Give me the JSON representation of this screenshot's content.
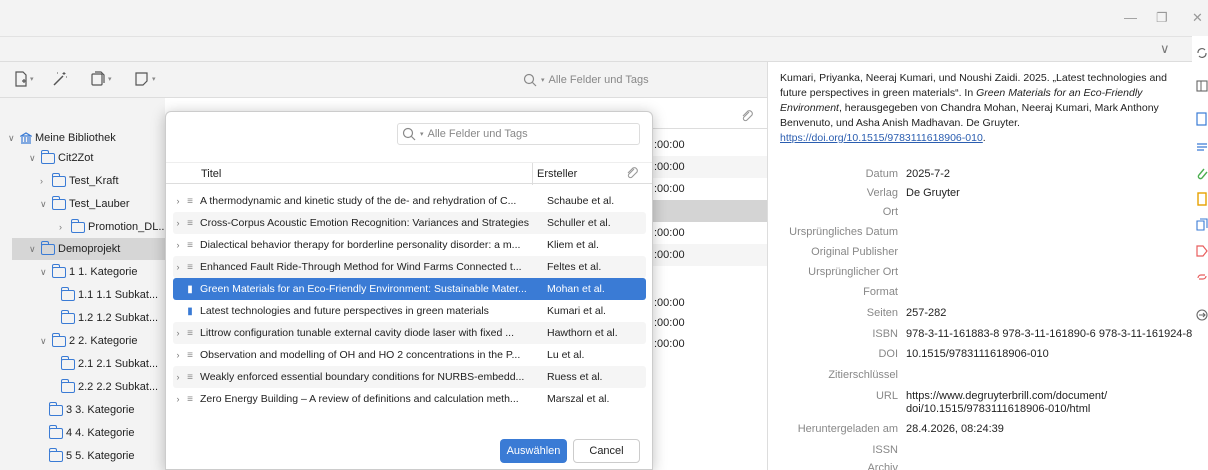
{
  "window": {
    "minimize_glyph": "—",
    "restore_glyph": "❐",
    "close_glyph": "✕",
    "chevron": "∨"
  },
  "toolbar": {
    "search_placeholder": "Alle Felder und Tags"
  },
  "tree": {
    "items": [
      {
        "label": "Meine Bibliothek"
      },
      {
        "label": "Cit2Zot"
      },
      {
        "label": "Test_Kraft"
      },
      {
        "label": "Test_Lauber"
      },
      {
        "label": "Promotion_DL..."
      },
      {
        "label": "Demoprojekt"
      },
      {
        "label": "1 1. Kategorie"
      },
      {
        "label": "1.1 1.1 Subkat..."
      },
      {
        "label": "1.2 1.2 Subkat..."
      },
      {
        "label": "2 2. Kategorie"
      },
      {
        "label": "2.1 2.1 Subkat..."
      },
      {
        "label": "2.2 2.2 Subkat..."
      },
      {
        "label": "3 3. Kategorie"
      },
      {
        "label": "4 4. Kategorie"
      },
      {
        "label": "5 5. Kategorie"
      }
    ]
  },
  "middle": {
    "times": [
      ":00:00",
      ":00:00",
      ":00:00",
      "",
      ":00:00",
      ":00:00",
      "",
      ":00:00",
      ":00:00",
      ":00:00"
    ]
  },
  "dialog": {
    "search_placeholder": "Alle Felder und Tags",
    "col_title": "Titel",
    "col_creator": "Ersteller",
    "rows": [
      {
        "title": "A thermodynamic and kinetic study of the de- and rehydration of C...",
        "creator": "Schaube et al."
      },
      {
        "title": "Cross-Corpus Acoustic Emotion Recognition: Variances and Strategies",
        "creator": "Schuller et al."
      },
      {
        "title": "Dialectical behavior therapy for borderline personality disorder: a m...",
        "creator": "Kliem et al."
      },
      {
        "title": "Enhanced Fault Ride-Through Method for Wind Farms Connected t...",
        "creator": "Feltes et al."
      },
      {
        "title": "Green Materials for an Eco-Friendly Environment: Sustainable Mater...",
        "creator": "Mohan et al."
      },
      {
        "title": "Latest technologies and future perspectives in green materials",
        "creator": "Kumari et al."
      },
      {
        "title": "Littrow configuration tunable external cavity diode laser with fixed ...",
        "creator": "Hawthorn et al."
      },
      {
        "title": "Observation and modelling of OH and HO 2 concentrations in the P...",
        "creator": "Lu et al."
      },
      {
        "title": "Weakly enforced essential boundary conditions for NURBS-embedd...",
        "creator": "Ruess et al."
      },
      {
        "title": "Zero Energy Building – A review of definitions and calculation meth...",
        "creator": "Marszal et al."
      }
    ],
    "ok_label": "Auswählen",
    "cancel_label": "Cancel"
  },
  "citation": {
    "text_a": "Kumari, Priyanka, Neeraj Kumari, und Noushi Zaidi. 2025. „Latest technologies and future perspectives in green materials“. In ",
    "text_book": "Green Materials for an Eco-Friendly Environment",
    "text_b": ", herausgegeben von Chandra Mohan, Neeraj Kumari, Mark Anthony Benvenuto, und Asha Anish Madhavan. De Gruyter. ",
    "link": "https://doi.org/10.1515/9783111618906-010",
    "tail": "."
  },
  "fields": [
    {
      "label": "Datum",
      "value": "2025-7-2"
    },
    {
      "label": "Verlag",
      "value": "De Gruyter"
    },
    {
      "label": "Ort",
      "value": ""
    },
    {
      "label": "Ursprüngliches Datum",
      "value": ""
    },
    {
      "label": "Original Publisher",
      "value": ""
    },
    {
      "label": "Ursprünglicher Ort",
      "value": ""
    },
    {
      "label": "Format",
      "value": ""
    },
    {
      "label": "Seiten",
      "value": "257-282"
    },
    {
      "label": "ISBN",
      "value": "978-3-11-161883-8 978-3-11-161890-6 978-3-11-161924-8"
    },
    {
      "label": "DOI",
      "value": "10.1515/9783111618906-010"
    },
    {
      "label": "Zitierschlüssel",
      "value": ""
    },
    {
      "label": "URL",
      "value": "https://www.degruyterbrill.com/document/\ndoi/10.1515/9783111618906-010/html"
    },
    {
      "label": "Heruntergeladen am",
      "value": "28.4.2026, 08:24:39"
    },
    {
      "label": "ISSN",
      "value": ""
    },
    {
      "label": "Archiv",
      "value": ""
    }
  ],
  "colors": {
    "accent": "#3a7bd5",
    "folder": "#3a7bd5"
  }
}
